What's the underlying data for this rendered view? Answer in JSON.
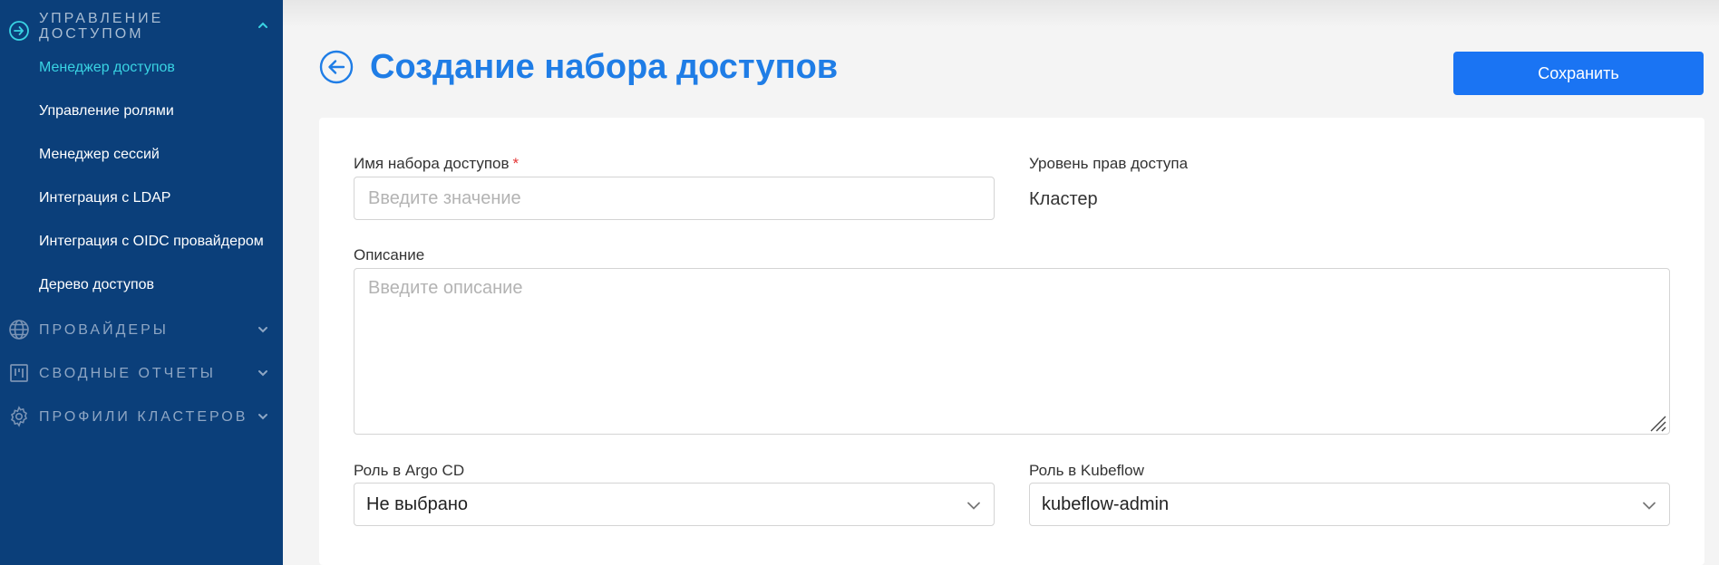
{
  "sidebar": {
    "sections": {
      "access": {
        "label": "Управление доступом",
        "label_line1": "УПРАВЛЕНИЕ",
        "label_line2": "ДОСТУПОМ",
        "icon": "login-arrow-icon",
        "expanded": true
      },
      "providers": {
        "label": "ПРОВАЙДЕРЫ",
        "icon": "globe-icon"
      },
      "reports": {
        "label": "СВОДНЫЕ ОТЧЕТЫ",
        "icon": "kanban-board-icon"
      },
      "cluster_profiles": {
        "label": "ПРОФИЛИ КЛАСТЕРОВ",
        "icon": "gear-icon"
      }
    },
    "items": [
      {
        "label": "Менеджер доступов",
        "active": true
      },
      {
        "label": "Управление ролями"
      },
      {
        "label": "Менеджер сессий"
      },
      {
        "label": "Интеграция с LDAP"
      },
      {
        "label": "Интеграция с OIDC провайдером"
      },
      {
        "label": "Дерево доступов"
      }
    ],
    "colors": {
      "background": "#0b3f7a",
      "active": "#39d3e3"
    }
  },
  "header": {
    "title": "Создание набора доступов",
    "save_label": "Сохранить"
  },
  "form": {
    "name": {
      "label": "Имя набора доступов",
      "required_mark": "*",
      "placeholder": "Введите значение",
      "value": ""
    },
    "access_level": {
      "label": "Уровень прав доступа",
      "value": "Кластер"
    },
    "description": {
      "label": "Описание",
      "placeholder": "Введите описание",
      "value": ""
    },
    "argo_role": {
      "label": "Роль в Argo CD",
      "value": "Не выбрано"
    },
    "kubeflow_role": {
      "label": "Роль в Kubeflow",
      "value": "kubeflow-admin"
    }
  },
  "colors": {
    "accent": "#1f7de6",
    "button": "#1a74f3"
  }
}
